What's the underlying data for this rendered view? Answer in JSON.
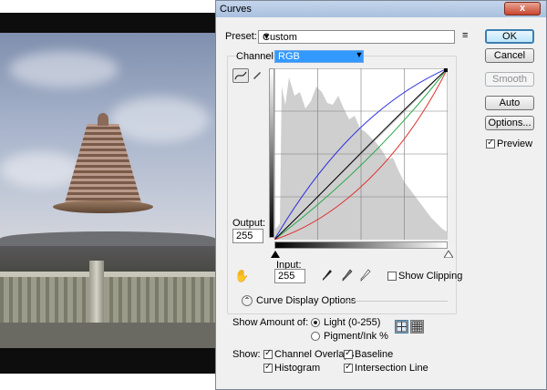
{
  "dialog": {
    "title": "Curves",
    "close_label": "x"
  },
  "preset": {
    "label": "Preset:",
    "value": "Custom"
  },
  "channel": {
    "label": "Channel:",
    "value": "RGB"
  },
  "output": {
    "label": "Output:",
    "value": "255"
  },
  "input": {
    "label": "Input:",
    "value": "255"
  },
  "show_clipping": {
    "label": "Show Clipping",
    "checked": false
  },
  "curve_display_options": {
    "label": "Curve Display Options"
  },
  "show_amount": {
    "label": "Show Amount of:",
    "options": [
      "Light (0-255)",
      "Pigment/Ink %"
    ],
    "selected": "Light (0-255)"
  },
  "show": {
    "label": "Show:",
    "items": [
      {
        "label": "Channel Overlays",
        "checked": true
      },
      {
        "label": "Baseline",
        "checked": true
      },
      {
        "label": "Histogram",
        "checked": true
      },
      {
        "label": "Intersection Line",
        "checked": true
      }
    ]
  },
  "buttons": {
    "ok": "OK",
    "cancel": "Cancel",
    "smooth": "Smooth",
    "auto": "Auto",
    "options": "Options..."
  },
  "preview": {
    "label": "Preview",
    "checked": true
  },
  "curves": {
    "red": "#e03030",
    "green": "#2aa84a",
    "blue": "#3030e0",
    "composite": "#000000"
  }
}
